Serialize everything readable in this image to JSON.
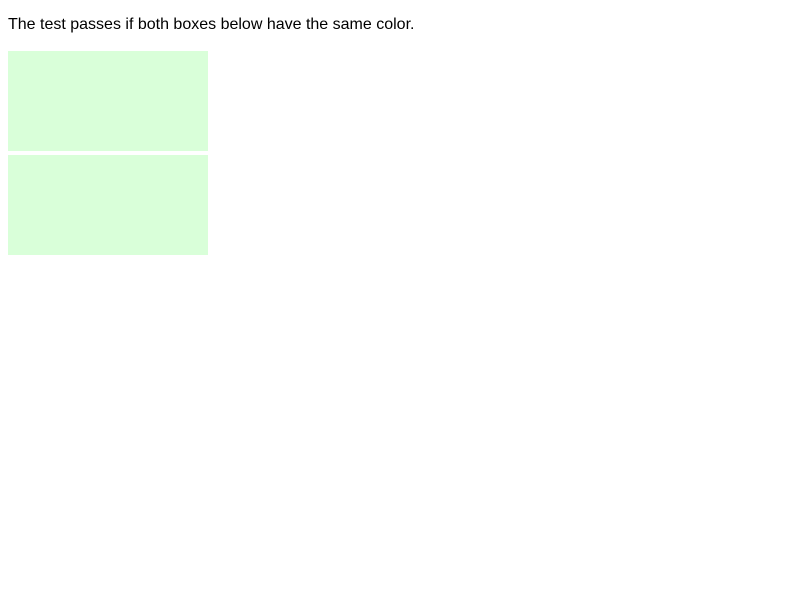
{
  "instruction": {
    "text": "The test passes if both boxes below have the same color."
  },
  "boxes": [
    {
      "color": "#d9ffd9"
    },
    {
      "color": "#d9ffd9"
    }
  ]
}
